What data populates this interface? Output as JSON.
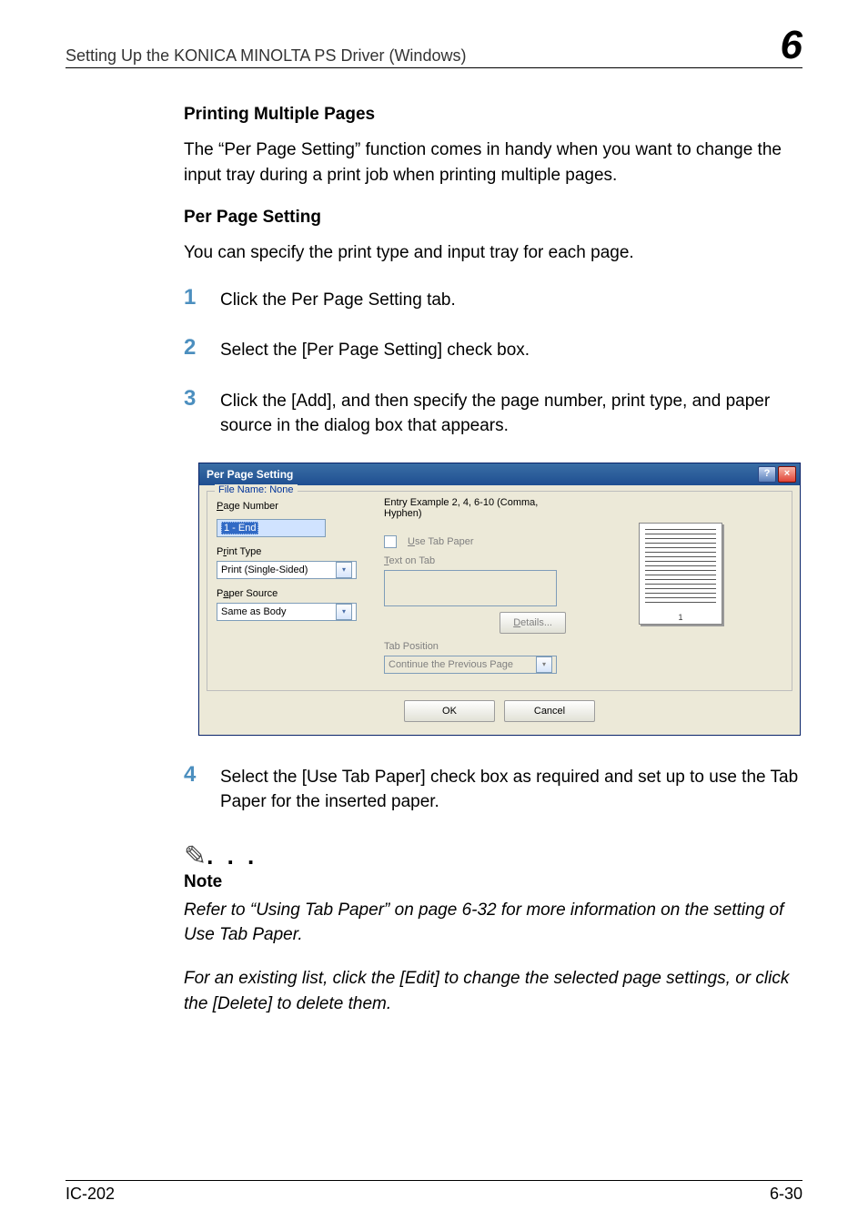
{
  "header": {
    "title": "Setting Up the KONICA MINOLTA PS Driver (Windows)",
    "chapter": "6"
  },
  "section1": {
    "heading": "Printing Multiple Pages",
    "paragraph": "The “Per Page Setting” function comes in handy when you want to change the input tray during a print job when printing multiple pages."
  },
  "section2": {
    "heading": "Per Page Setting",
    "paragraph": "You can specify the print type and input tray for each page."
  },
  "steps": {
    "n1": "1",
    "t1": "Click the Per Page Setting tab.",
    "n2": "2",
    "t2": "Select the [Per Page Setting] check box.",
    "n3": "3",
    "t3": "Click the [Add], and then specify the page number, print type, and paper source in the dialog box that appears.",
    "n4": "4",
    "t4": "Select the [Use Tab Paper] check box as required and set up to use the Tab Paper for the inserted paper."
  },
  "dialog": {
    "title": "Per Page Setting",
    "file_name_label": "File Name: None",
    "page_number_label": "Page Number",
    "page_number_value": "1 - End",
    "entry_example": "Entry Example 2, 4, 6-10 (Comma, Hyphen)",
    "print_type_label": "Print Type",
    "print_type_value": "Print (Single-Sided)",
    "paper_source_label": "Paper Source",
    "paper_source_value": "Same as Body",
    "use_tab_paper_label": "Use Tab Paper",
    "text_on_tab_label": "Text on Tab",
    "details_label": "Details...",
    "tab_position_label": "Tab Position",
    "tab_position_value": "Continue the Previous Page",
    "ok_label": "OK",
    "cancel_label": "Cancel",
    "help_label": "?",
    "close_label": "×"
  },
  "note": {
    "icon_dots": ". . .",
    "heading": "Note",
    "para1": "Refer to “Using Tab Paper” on page 6-32 for more information on the setting of Use Tab Paper.",
    "para2": "For an existing list, click the [Edit] to change the selected page settings, or click the [Delete] to delete them."
  },
  "footer": {
    "left": "IC-202",
    "right": "6-30"
  }
}
